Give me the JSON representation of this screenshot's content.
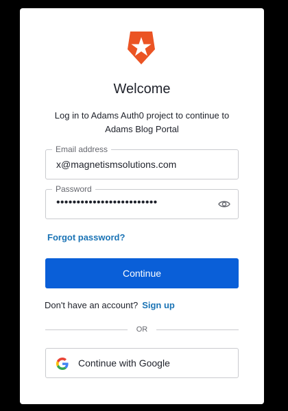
{
  "header": {
    "logo_icon": "auth0-shield-star-icon",
    "brand_color": "#eb5424",
    "title": "Welcome",
    "subtitle": "Log in to Adams Auth0 project to continue to Adams Blog Portal"
  },
  "form": {
    "email": {
      "label": "Email address",
      "value": "x@magnetismsolutions.com"
    },
    "password": {
      "label": "Password",
      "masked_value": "•••••••••••••••••••••••••",
      "toggle_icon": "eye-icon"
    },
    "forgot_password_label": "Forgot password?",
    "continue_label": "Continue",
    "accent_color": "#0a5fd8",
    "link_color": "#1a73b5"
  },
  "signup": {
    "prompt": "Don't have an account?",
    "link_label": "Sign up"
  },
  "divider": {
    "label": "OR"
  },
  "social": {
    "google_label": "Continue with Google",
    "google_icon": "google-g-icon"
  }
}
